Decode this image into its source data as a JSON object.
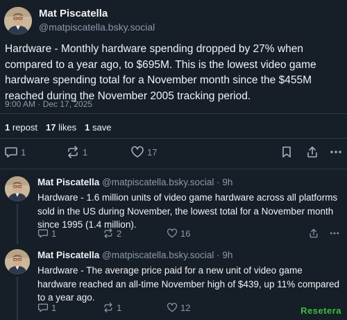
{
  "main_post": {
    "display_name": "Mat Piscatella",
    "handle": "@matpiscatella.bsky.social",
    "text": "Hardware - Monthly hardware spending dropped by 27% when compared to a year ago, to $695M. This is the lowest video game hardware spending total for a November month since the $455M reached during the November 2005 tracking period.",
    "timestamp": "9:00 AM · Dec 17, 2025",
    "stats": {
      "reposts_count": "1",
      "reposts_label": "repost",
      "likes_count": "17",
      "likes_label": "likes",
      "saves_count": "1",
      "saves_label": "save"
    },
    "actions": {
      "reply_count": "1",
      "repost_count": "1",
      "like_count": "17"
    }
  },
  "replies": [
    {
      "display_name": "Mat Piscatella",
      "handle": "@matpiscatella.bsky.social",
      "age": "· 9h",
      "text": "Hardware - 1.6 million units of video game hardware across all platforms sold in the US during November, the lowest total for a November month since 1995 (1.4 million).",
      "reply_count": "1",
      "repost_count": "2",
      "like_count": "16"
    },
    {
      "display_name": "Mat Piscatella",
      "handle": "@matpiscatella.bsky.social",
      "age": "· 9h",
      "text": "Hardware - The average price paid for a new unit of video game hardware reached an all-time November high of $439, up 11% compared to a year ago.",
      "reply_count": "1",
      "repost_count": "1",
      "like_count": "12"
    }
  ],
  "watermark": "Resetera",
  "colors": {
    "background": "#161e27",
    "text": "#f1f3f5",
    "muted": "#8c9aab",
    "divider": "#2b3845"
  }
}
